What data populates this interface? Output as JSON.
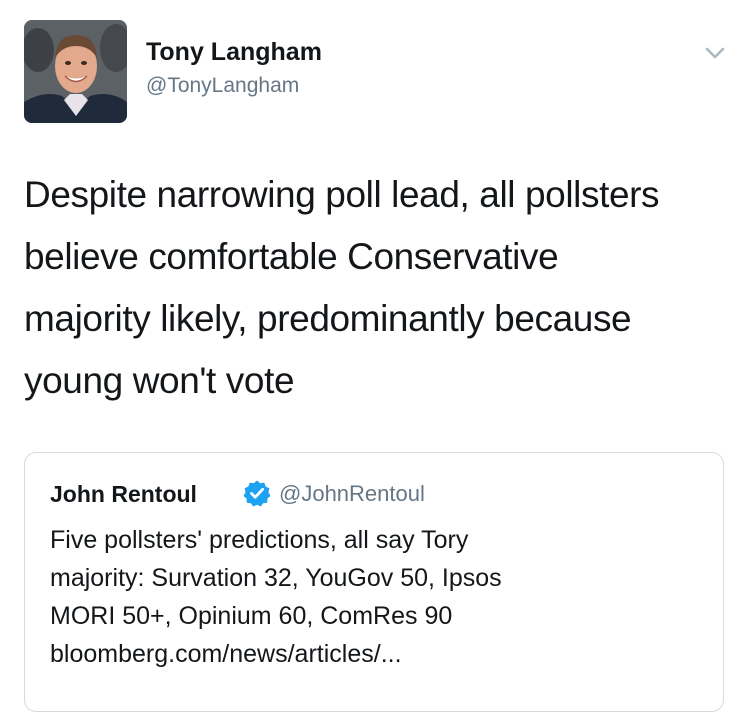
{
  "tweet": {
    "author": {
      "display_name": "Tony Langham",
      "handle": "@TonyLangham",
      "avatar_icon": "profile-photo"
    },
    "menu_icon": "chevron-down-icon",
    "text_lines": [
      "Despite narrowing poll lead, all pollsters",
      "believe comfortable Conservative",
      "majority likely, predominantly because",
      "young won't vote"
    ]
  },
  "quoted_tweet": {
    "author": {
      "display_name": "John Rentoul",
      "handle": "@JohnRentoul",
      "verified": true,
      "verified_icon": "verified-badge-icon"
    },
    "text_lines": [
      "Five pollsters' predictions, all say Tory",
      "majority: Survation 32, YouGov 50, Ipsos",
      "MORI 50+, Opinium 60, ComRes 90",
      "bloomberg.com/news/articles/..."
    ]
  },
  "colors": {
    "text_primary": "#14171a",
    "text_secondary": "#657786",
    "verified_blue": "#1da1f2",
    "card_border": "#d4dbe1"
  }
}
